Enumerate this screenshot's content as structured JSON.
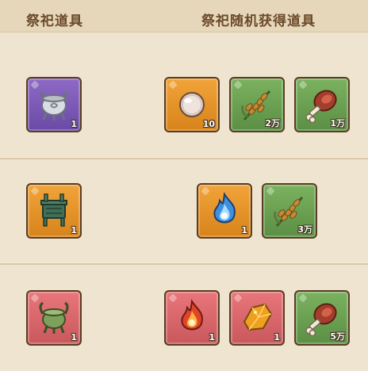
{
  "header": {
    "left_label": "祭祀道具",
    "right_label": "祭祀随机获得道具"
  },
  "rows": [
    {
      "offering": {
        "icon": "silver-censer-icon",
        "color": "purple",
        "count": "1"
      },
      "rewards": [
        {
          "icon": "pearl-icon",
          "color": "orange",
          "count": "10"
        },
        {
          "icon": "grain-icon",
          "color": "green",
          "count": "2万"
        },
        {
          "icon": "meat-icon",
          "color": "green",
          "count": "1万"
        }
      ]
    },
    {
      "offering": {
        "icon": "bronze-ding-icon",
        "color": "orange",
        "count": "1"
      },
      "rewards": [
        {
          "icon": "blue-flame-icon",
          "color": "orange",
          "count": "1"
        },
        {
          "icon": "grain-icon",
          "color": "green",
          "count": "3万"
        }
      ]
    },
    {
      "offering": {
        "icon": "jade-censer-icon",
        "color": "red",
        "count": "1"
      },
      "rewards": [
        {
          "icon": "red-flame-icon",
          "color": "red",
          "count": "1"
        },
        {
          "icon": "amber-crystal-icon",
          "color": "red",
          "count": "1"
        },
        {
          "icon": "meat-icon",
          "color": "green",
          "count": "5万"
        }
      ]
    }
  ]
}
